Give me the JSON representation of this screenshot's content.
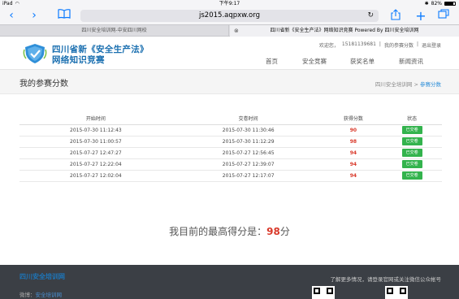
{
  "status_bar": {
    "device": "iPad",
    "time": "下午9:17",
    "battery": "82%"
  },
  "browser": {
    "url": "js2015.aqpxw.org",
    "tabs": [
      {
        "title": "四川安全培训网-中安四川网校"
      },
      {
        "title": "四川省新《安全生产法》网络知识竞赛 Powered By 四川安全培训网"
      }
    ]
  },
  "header": {
    "logo_line1": "四川省新《安全生产法》",
    "logo_line2": "网络知识竞赛",
    "welcome": "欢迎您，",
    "user_phone": "15181139681",
    "my_scores": "我的参赛分数",
    "logout": "退出登录",
    "nav": [
      "首页",
      "安全竞赛",
      "获奖名单",
      "新闻资讯"
    ]
  },
  "page": {
    "title": "我的参赛分数",
    "breadcrumb": [
      "四川安全培训网",
      "参赛分数"
    ]
  },
  "table": {
    "headers": [
      "开始时间",
      "交卷时间",
      "获得分数",
      "状态"
    ],
    "rows": [
      {
        "start": "2015-07-30 11:12:43",
        "end": "2015-07-30 11:30:46",
        "score": "90",
        "status": "已交卷"
      },
      {
        "start": "2015-07-30 11:00:57",
        "end": "2015-07-30 11:12:29",
        "score": "98",
        "status": "已交卷"
      },
      {
        "start": "2015-07-27 12:47:27",
        "end": "2015-07-27 12:56:45",
        "score": "94",
        "status": "已交卷"
      },
      {
        "start": "2015-07-27 12:22:04",
        "end": "2015-07-27 12:39:07",
        "score": "94",
        "status": "已交卷"
      },
      {
        "start": "2015-07-27 12:02:04",
        "end": "2015-07-27 12:17:07",
        "score": "94",
        "status": "已交卷"
      }
    ]
  },
  "summary": {
    "label": "我目前的最高得分是：",
    "score": "98",
    "unit": "分"
  },
  "footer": {
    "logo": "四川安全培训网",
    "weibo_label": "微博：",
    "weibo_link": "安全培训网",
    "tip": "了解更多情况，请登录官网或关注微信公众帐号"
  },
  "colors": {
    "accent": "#1a6fb0",
    "score_red": "#d9392a",
    "status_green": "#33b34d",
    "footer_bg": "#3b3f45"
  }
}
